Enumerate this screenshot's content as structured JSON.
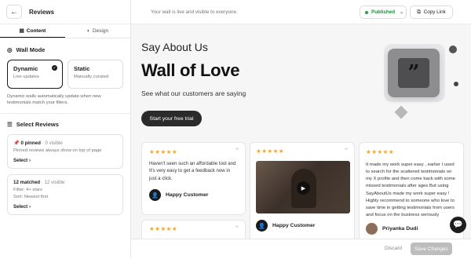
{
  "sidebar": {
    "back_icon": "arrow-left-icon",
    "title": "Reviews",
    "tabs": [
      {
        "label": "Content",
        "icon": "pages-icon",
        "active": true
      },
      {
        "label": "Design",
        "icon": "palette-icon",
        "active": false
      }
    ],
    "wall_mode": {
      "heading": "Wall Mode",
      "options": [
        {
          "title": "Dynamic",
          "subtitle": "Live updates",
          "selected": true
        },
        {
          "title": "Static",
          "subtitle": "Manually curated",
          "selected": false
        }
      ],
      "note": "Dynamic walls automatically update when new testimonials match your filters."
    },
    "select_reviews": {
      "heading": "Select Reviews",
      "pinned": {
        "count": "0 pinned",
        "separator": " · ",
        "visible": "0 visible",
        "description": "Pinned reviews always show on top of page",
        "action": "Select"
      },
      "matched": {
        "count": "12 matched",
        "separator": " · ",
        "visible": "12 visible",
        "filter": "Filter: 4+ stars",
        "sort": "Sort: Newest first",
        "action": "Select"
      }
    }
  },
  "topbar": {
    "status_message": "Your wall is live and visible to everyone.",
    "published_label": "Published",
    "copy_link_label": "Copy Link"
  },
  "hero": {
    "kicker": "Say About Us",
    "title": "Wall of Love",
    "subtitle": "See what our customers are saying",
    "cta_label": "Start your free trial"
  },
  "testimonials": [
    {
      "stars": "★★★★★",
      "text": "Haven't seen such an affordable tool and It's very easy to get a feedback now in just a click.",
      "author": "Happy Customer"
    },
    {
      "stars": "★★★★★",
      "author": "Happy Customer"
    },
    {
      "stars": "★★★★★",
      "text": "It made my work super easy , earlier I used to search for the scattered testimonials on my X profile and then come back with some missed testimonials after ages But using SayAboutUs made my work super easy ! Highly recommend to someone who love to save time in getting testimonials from users and focus on the business seriously",
      "author": "Priyanka Dudi"
    },
    {
      "stars": "★★★★★"
    }
  ],
  "footer": {
    "discard_label": "Discard",
    "save_label": "Save Changes"
  },
  "colors": {
    "accent": "#1a1a1a",
    "published_green": "#22a447",
    "star": "#f5a623"
  }
}
